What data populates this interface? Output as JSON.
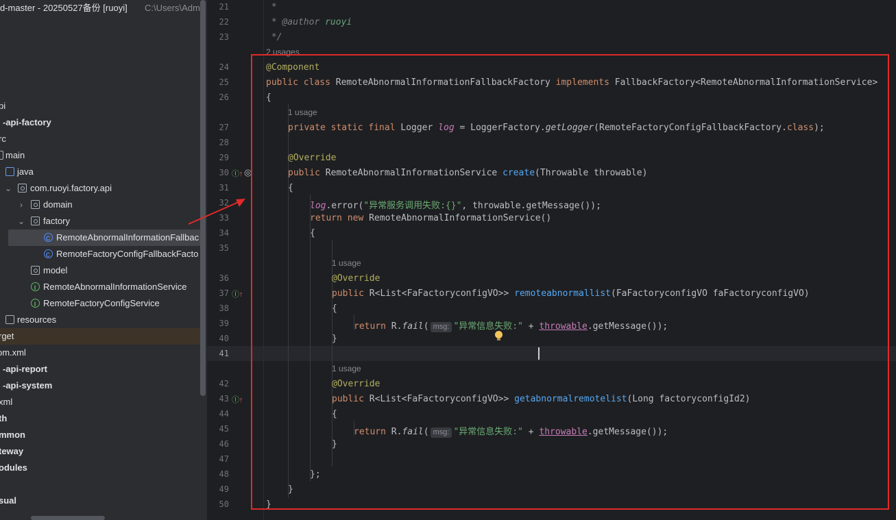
{
  "tree": {
    "title": "d-master - 20250527备份 [ruoyi]",
    "title_path": "C:\\Users\\Admi",
    "rows": [
      {
        "label": "pi"
      },
      {
        "label": "-api-factory"
      },
      {
        "label": "rc"
      },
      {
        "label": "main"
      },
      {
        "label": "java"
      },
      {
        "label": "com.ruoyi.factory.api"
      },
      {
        "label": "domain"
      },
      {
        "label": "factory"
      },
      {
        "label": "RemoteAbnormalInformationFallbac"
      },
      {
        "label": "RemoteFactoryConfigFallbackFacto"
      },
      {
        "label": "model"
      },
      {
        "label": "RemoteAbnormalInformationService"
      },
      {
        "label": "RemoteFactoryConfigService"
      },
      {
        "label": "resources"
      },
      {
        "label": "rget"
      },
      {
        "label": "om.xml"
      },
      {
        "label": "-api-report"
      },
      {
        "label": "-api-system"
      },
      {
        "label": "xml"
      },
      {
        "label": "th"
      },
      {
        "label": "mmon"
      },
      {
        "label": "teway"
      },
      {
        "label": "odules"
      },
      {
        "label": "sual"
      }
    ]
  },
  "editor": {
    "line_numbers": [
      "21",
      "22",
      "23",
      "24",
      "25",
      "26",
      "27",
      "28",
      "29",
      "30",
      "31",
      "32",
      "33",
      "34",
      "35",
      "36",
      "37",
      "38",
      "39",
      "40",
      "41",
      "42",
      "43",
      "44",
      "45",
      "46",
      "47",
      "48",
      "49",
      "50"
    ],
    "usage_hints": {
      "class": "2 usages",
      "log": "1 usage",
      "remoteabnormallist": "1 usage",
      "getabnormalremotelist": "1 usage"
    },
    "param_hint": "msg:",
    "lines": {
      "l21": " *",
      "l22_at": " * @author",
      "l22_name": " ruoyi",
      "l23": " */",
      "l24": "@Component",
      "l25_kw": "public class",
      "l25_name": " RemoteAbnormalInformationFallbackFactory ",
      "l25_impl": "implements",
      "l25_rest": " FallbackFactory<RemoteAbnormalInformationService>",
      "l26": "{",
      "l27_kw": "private static final",
      "l27_type": " Logger ",
      "l27_var": "log",
      "l27_eq": " = LoggerFactory.",
      "l27_fn": "getLogger",
      "l27_arg": "(RemoteFactoryConfigFallbackFactory.",
      "l27_cls": "class",
      "l27_end": ");",
      "l29": "@Override",
      "l30_kw": "public",
      "l30_type": " RemoteAbnormalInformationService ",
      "l30_fn": "create",
      "l30_args": "(Throwable throwable)",
      "l31": "{",
      "l32_var": "log",
      "l32_call": ".error(",
      "l32_str": "\"异常服务调用失败:{}\"",
      "l32_rest": ", throwable.getMessage());",
      "l33_kw": "return new",
      "l33_rest": " RemoteAbnormalInformationService()",
      "l34": "{",
      "l36": "@Override",
      "l37_kw": "public",
      "l37_type": " R<List<FaFactoryconfigVO>> ",
      "l37_fn": "remoteabnormallist",
      "l37_args": "(FaFactoryconfigVO faFactoryconfigVO)",
      "l38": "{",
      "l39_kw": "return",
      "l39_r": " R.",
      "l39_fn": "fail",
      "l39_open": "(",
      "l39_str": "\"异常信息失败:\"",
      "l39_plus": " + ",
      "l39_var": "throwable",
      "l39_end": ".getMessage());",
      "l40": "}",
      "l42": "@Override",
      "l43_kw": "public",
      "l43_type": " R<List<FaFactoryconfigVO>> ",
      "l43_fn": "getabnormalremotelist",
      "l43_args": "(Long factoryconfigId2)",
      "l44": "{",
      "l45_kw": "return",
      "l45_r": " R.",
      "l45_fn": "fail",
      "l45_open": "(",
      "l45_str": "\"异常信息失败:\"",
      "l45_plus": " + ",
      "l45_var": "throwable",
      "l45_end": ".getMessage());",
      "l46": "}",
      "l48": "};",
      "l49": "}",
      "l50": "}"
    }
  },
  "gutter_icons": {
    "override_up": "↑",
    "target": "◎"
  },
  "colors": {
    "annotation_box": "#e12a2a",
    "keyword": "#cf8e6d",
    "annotation": "#b3ae60",
    "method": "#56a8f5",
    "string": "#6aab73"
  }
}
